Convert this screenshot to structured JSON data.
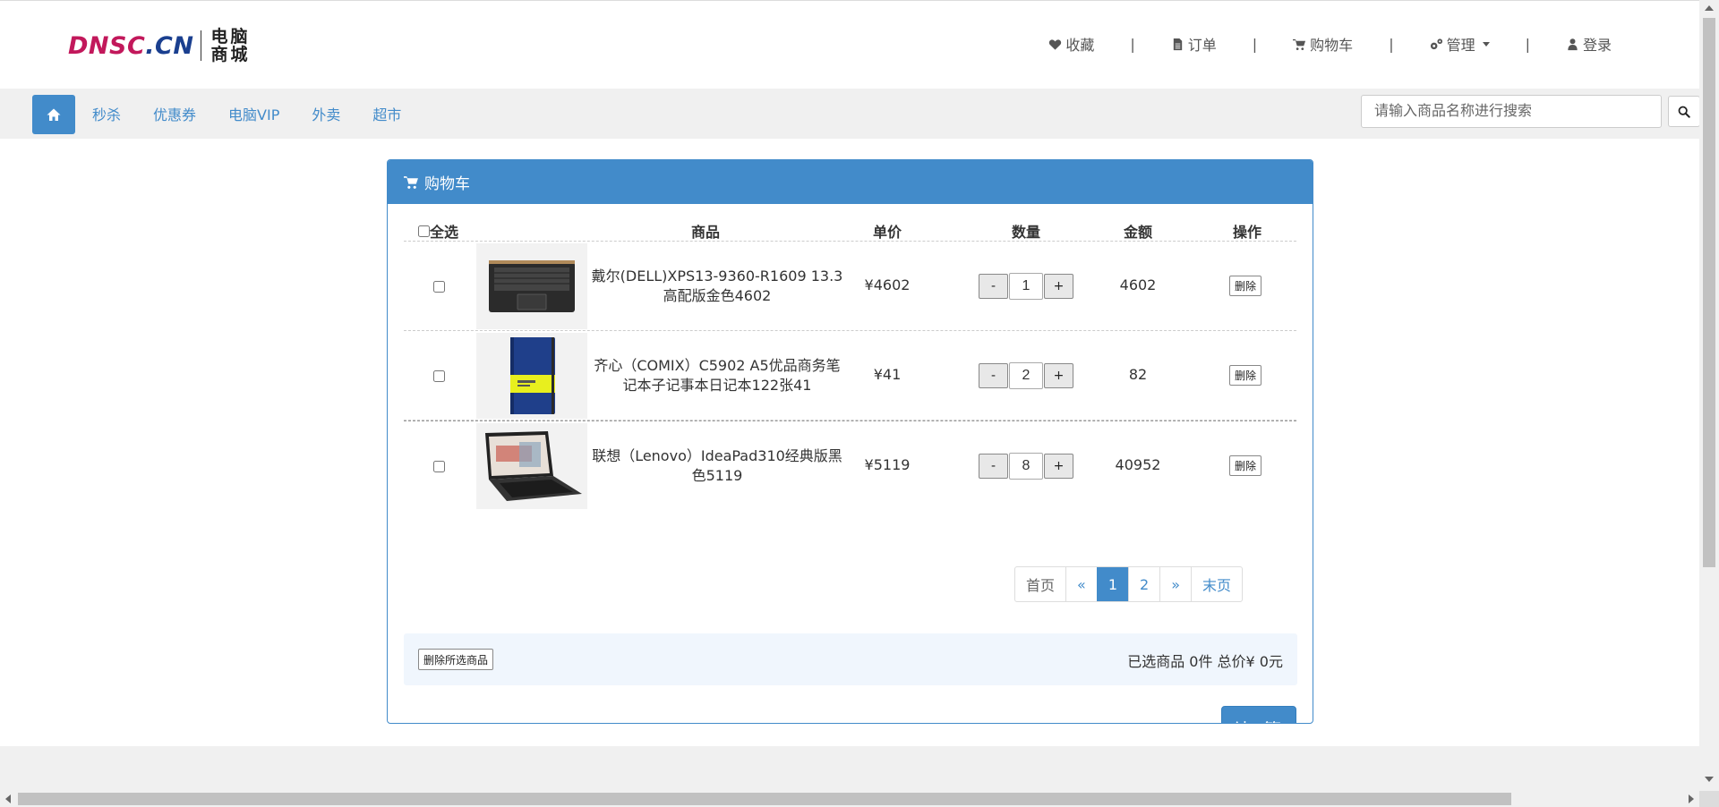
{
  "header": {
    "logo": {
      "brand_part1": "DNSC",
      "brand_part2": ".CN",
      "sub_line1": "电脑",
      "sub_line2": "商城"
    },
    "nav": [
      {
        "label": "收藏",
        "icon": "heart-icon"
      },
      {
        "label": "订单",
        "icon": "file-icon"
      },
      {
        "label": "购物车",
        "icon": "cart-icon"
      },
      {
        "label": "管理",
        "icon": "gears-icon",
        "dropdown": true
      },
      {
        "label": "登录",
        "icon": "user-icon"
      }
    ],
    "separator": "|"
  },
  "categories": {
    "home_icon": "home-icon",
    "links": [
      "秒杀",
      "优惠券",
      "电脑VIP",
      "外卖",
      "超市"
    ]
  },
  "search": {
    "placeholder": "请输入商品名称进行搜索",
    "value": "",
    "icon": "search-icon"
  },
  "cart": {
    "title": "购物车",
    "columns": {
      "select_all": "全选",
      "product": "商品",
      "unit_price": "单价",
      "quantity": "数量",
      "amount": "金额",
      "actions": "操作"
    },
    "items": [
      {
        "name": "戴尔(DELL)XPS13-9360-R1609 13.3高配版金色4602",
        "price": "¥4602",
        "qty": "1",
        "amount": "4602",
        "delete_label": "删除",
        "minus": "-",
        "plus": "+",
        "checked": false
      },
      {
        "name": "齐心（COMIX）C5902 A5优品商务笔记本子记事本日记本122张41",
        "price": "¥41",
        "qty": "2",
        "amount": "82",
        "delete_label": "删除",
        "minus": "-",
        "plus": "+",
        "checked": false
      },
      {
        "name": "联想（Lenovo）IdeaPad310经典版黑色5119",
        "price": "¥5119",
        "qty": "8",
        "amount": "40952",
        "delete_label": "删除",
        "minus": "-",
        "plus": "+",
        "checked": false
      }
    ],
    "pagination": {
      "first": "首页",
      "prev": "«",
      "pages": [
        "1",
        "2"
      ],
      "current": "1",
      "next": "»",
      "last": "末页"
    },
    "footer": {
      "delete_selected": "删除所选商品",
      "summary": "已选商品 0件 总价¥ 0元"
    },
    "checkout_label": "结 算"
  },
  "colors": {
    "primary": "#428bca",
    "logo_pink": "#c2185b",
    "logo_navy": "#1a3f8f",
    "bar_gray": "#f0f0f0",
    "summary_bg": "#f0f6fd"
  }
}
